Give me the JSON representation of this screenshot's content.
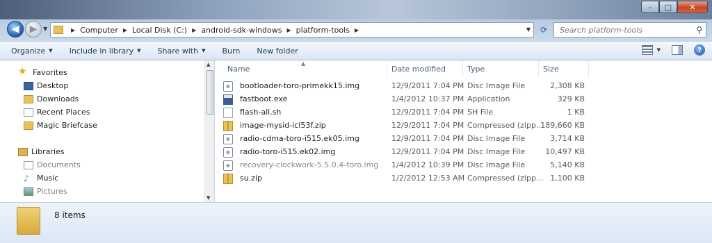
{
  "window": {
    "minimize": "–",
    "maximize": "□",
    "close": "✕"
  },
  "nav": {
    "back": "◀",
    "forward": "▶",
    "breadcrumb": [
      "Computer",
      "Local Disk (C:)",
      "android-sdk-windows",
      "platform-tools"
    ],
    "refresh": "⟳",
    "search_placeholder": "Search platform-tools"
  },
  "toolbar": {
    "organize": "Organize",
    "include_in_library": "Include in library",
    "share_with": "Share with",
    "burn": "Burn",
    "new_folder": "New folder",
    "help": "?"
  },
  "sidebar": {
    "favorites_label": "Favorites",
    "favorites": [
      "Desktop",
      "Downloads",
      "Recent Places",
      "Magic Briefcase"
    ],
    "libraries_label": "Libraries",
    "libraries": [
      "Documents",
      "Music",
      "Pictures"
    ]
  },
  "columns": {
    "name": "Name",
    "date": "Date modified",
    "type": "Type",
    "size": "Size"
  },
  "files": [
    {
      "name": "bootloader-toro-primekk15.img",
      "date": "12/9/2011 7:04 PM",
      "type": "Disc Image File",
      "size": "2,308 KB",
      "icon": "disc-image-icon"
    },
    {
      "name": "fastboot.exe",
      "date": "1/4/2012 10:37 PM",
      "type": "Application",
      "size": "329 KB",
      "icon": "application-icon"
    },
    {
      "name": "flash-all.sh",
      "date": "12/9/2011 7:04 PM",
      "type": "SH File",
      "size": "1 KB",
      "icon": "file-icon"
    },
    {
      "name": "image-mysid-icl53f.zip",
      "date": "12/9/2011 7:04 PM",
      "type": "Compressed (zipp...",
      "size": "189,660 KB",
      "icon": "zip-icon"
    },
    {
      "name": "radio-cdma-toro-i515.ek05.img",
      "date": "12/9/2011 7:04 PM",
      "type": "Disc Image File",
      "size": "3,714 KB",
      "icon": "disc-image-icon"
    },
    {
      "name": "radio-toro-i515.ek02.img",
      "date": "12/9/2011 7:04 PM",
      "type": "Disc Image File",
      "size": "10,497 KB",
      "icon": "disc-image-icon"
    },
    {
      "name": "recovery-clockwork-5.5.0.4-toro.img",
      "date": "1/4/2012 10:39 PM",
      "type": "Disc Image File",
      "size": "5,140 KB",
      "icon": "disc-image-icon"
    },
    {
      "name": "su.zip",
      "date": "1/2/2012 12:53 AM",
      "type": "Compressed (zipp...",
      "size": "1,100 KB",
      "icon": "zip-icon"
    }
  ],
  "status": {
    "item_count": "8 items"
  }
}
